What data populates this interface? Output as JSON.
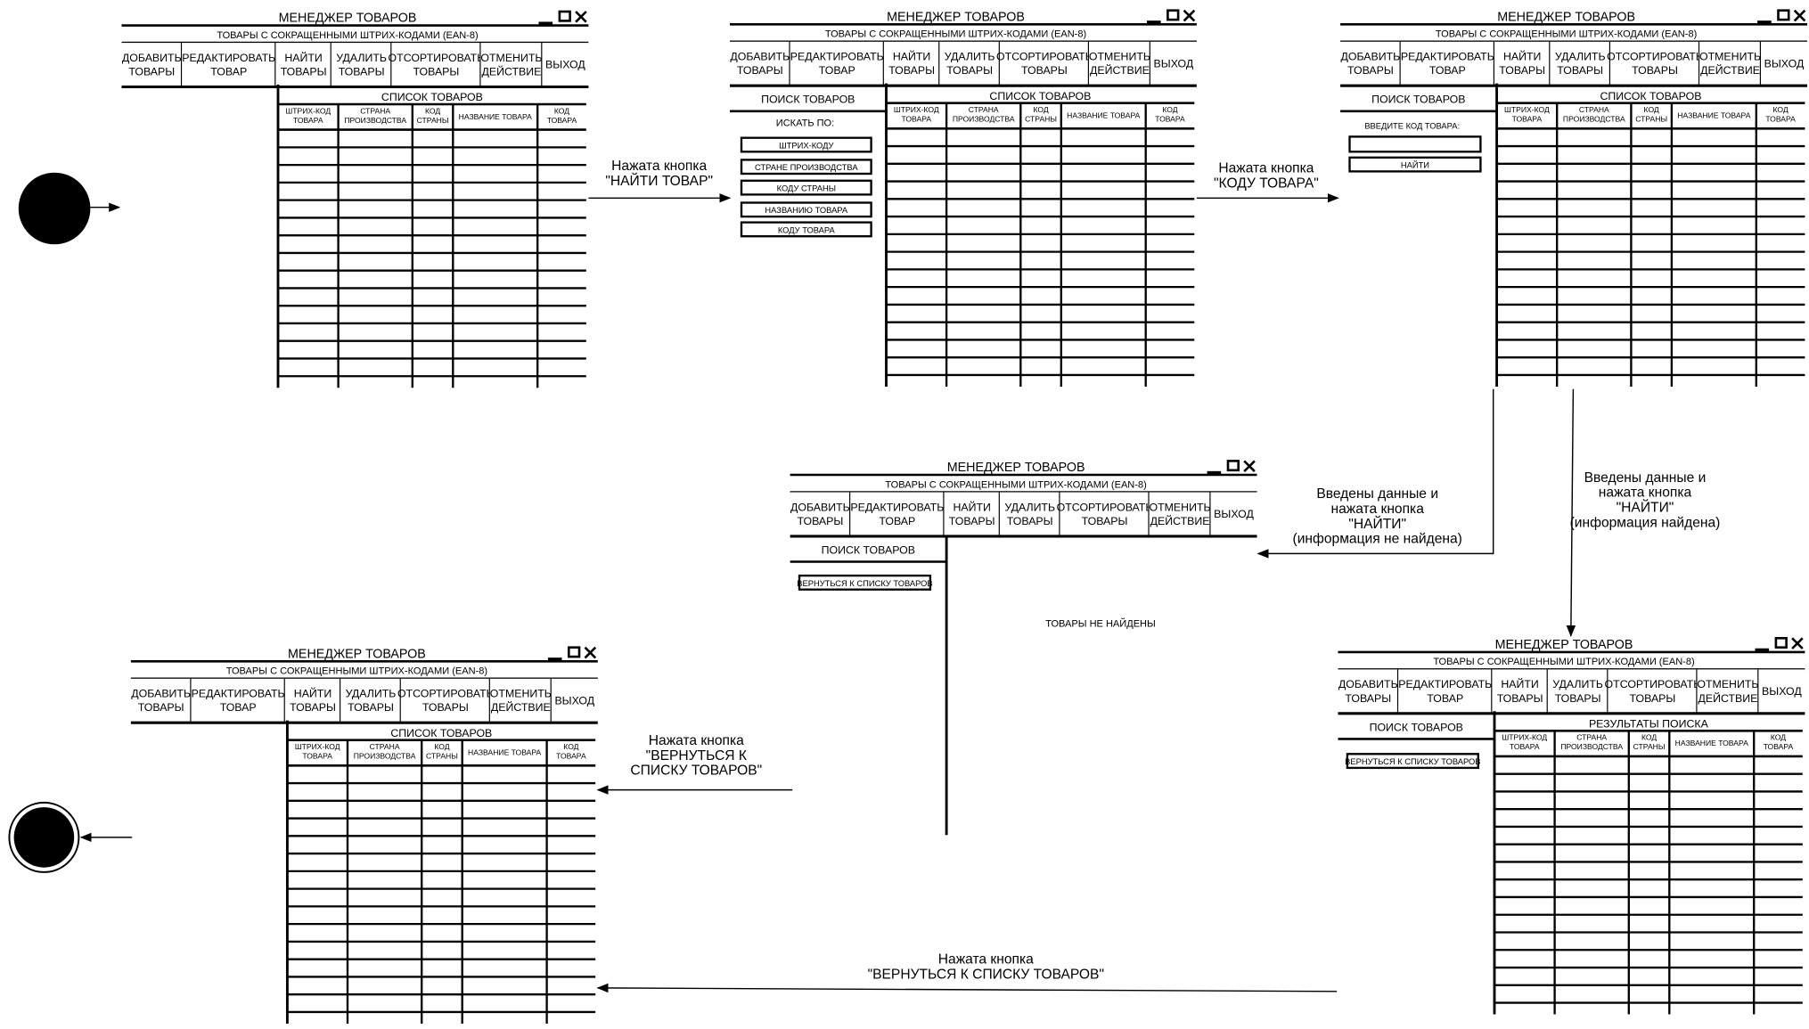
{
  "window": {
    "title": "МЕНЕДЖЕР ТОВАРОВ",
    "subtitle": "ТОВАРЫ С СОКРАЩЕННЫМИ ШТРИХ-КОДАМИ (EAN-8)",
    "controls": [
      "minimize-icon",
      "maximize-icon",
      "close-icon"
    ]
  },
  "menu": [
    {
      "id": "add",
      "lines": [
        "ДОБАВИТЬ",
        "ТОВАРЫ"
      ]
    },
    {
      "id": "edit",
      "lines": [
        "РЕДАКТИРОВАТЬ",
        "ТОВАР"
      ]
    },
    {
      "id": "find",
      "lines": [
        "НАЙТИ",
        "ТОВАРЫ"
      ]
    },
    {
      "id": "delete",
      "lines": [
        "УДАЛИТЬ",
        "ТОВАРЫ"
      ]
    },
    {
      "id": "sort",
      "lines": [
        "ОТСОРТИРОВАТЬ",
        "ТОВАРЫ"
      ]
    },
    {
      "id": "undo",
      "lines": [
        "ОТМЕНИТЬ",
        "ДЕЙСТВИЕ"
      ]
    },
    {
      "id": "exit",
      "lines": [
        "ВЫХОД"
      ]
    }
  ],
  "table": {
    "list_title": "СПИСОК ТОВАРОВ",
    "results_title": "РЕЗУЛЬТАТЫ ПОИСКА",
    "columns": [
      [
        "ШТРИХ-КОД",
        "ТОВАРА"
      ],
      [
        "СТРАНА",
        "ПРОИЗВОДСТВА"
      ],
      [
        "КОД",
        "СТРАНЫ"
      ],
      [
        "НАЗВАНИЕ ТОВАРА"
      ],
      [
        "КОД",
        "ТОВАРА"
      ]
    ]
  },
  "search": {
    "panel_title": "ПОИСК ТОВАРОВ",
    "search_by": "ИСКАТЬ ПО:",
    "options": [
      "ШТРИХ-КОДУ",
      "СТРАНЕ ПРОИЗВОДСТВА",
      "КОДУ СТРАНЫ",
      "НАЗВАНИЮ ТОВАРА",
      "КОДУ ТОВАРА"
    ],
    "enter_code": "ВВЕДИТЕ КОД ТОВАРА:",
    "find_button": "НАЙТИ",
    "back_button": "ВЕРНУТЬСЯ К СПИСКУ ТОВАРОВ",
    "not_found": "ТОВАРЫ НЕ НАЙДЕНЫ"
  },
  "transitions": {
    "t1": [
      "Нажата кнопка",
      "\"НАЙТИ ТОВАР\""
    ],
    "t2": [
      "Нажата кнопка",
      "\"КОДУ ТОВАРА\""
    ],
    "t3": [
      "Введены данные и",
      "нажата кнопка",
      "\"НАЙТИ\"",
      "(информация не найдена)"
    ],
    "t4": [
      "Введены данные и",
      "нажата кнопка",
      "\"НАЙТИ\"",
      "(информация найдена)"
    ],
    "t5": [
      "Нажата кнопка",
      "\"ВЕРНУТЬСЯ К",
      "СПИСКУ ТОВАРОВ\""
    ],
    "t6": [
      "Нажата кнопка",
      "\"ВЕРНУТЬСЯ К СПИСКУ ТОВАРОВ\""
    ]
  }
}
